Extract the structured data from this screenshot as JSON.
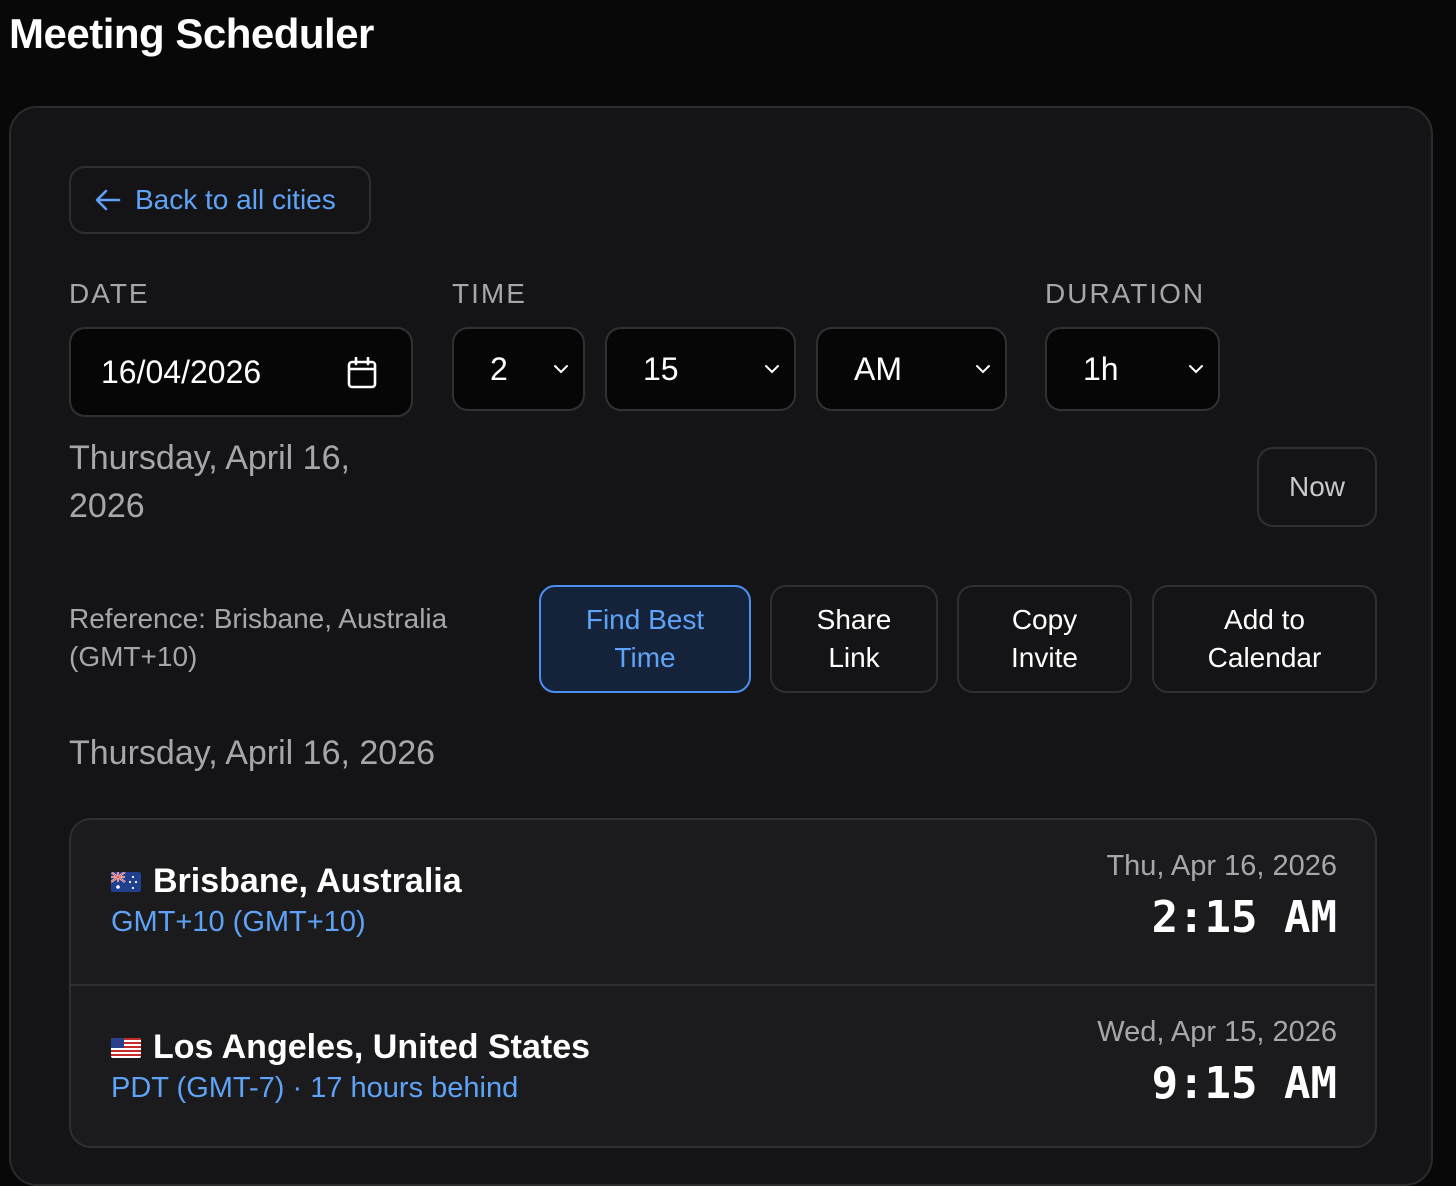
{
  "app": {
    "title": "Meeting Scheduler"
  },
  "nav": {
    "back_label": "Back to all cities",
    "back_icon": "arrow-left-icon"
  },
  "form": {
    "date_label": "DATE",
    "time_label": "TIME",
    "duration_label": "DURATION",
    "date_value": "16/04/2026",
    "hour_value": "2",
    "minute_value": "15",
    "ampm_value": "AM",
    "duration_value": "1h",
    "long_date": "Thursday, April 16, 2026",
    "now_label": "Now"
  },
  "reference": {
    "text": "Reference: Brisbane, Australia (GMT+10)"
  },
  "actions": {
    "find_best_time": "Find Best Time",
    "share_link": "Share Link",
    "copy_invite": "Copy Invite",
    "add_to_calendar": "Add to Calendar"
  },
  "results": {
    "section_date": "Thursday, April 16, 2026",
    "cities": [
      {
        "flag": "australia-flag",
        "name": "Brisbane, Australia",
        "tz": "GMT+10 (GMT+10)",
        "date": "Thu, Apr 16, 2026",
        "time": "2:15 AM"
      },
      {
        "flag": "united-states-flag",
        "name": "Los Angeles, United States",
        "tz": "PDT (GMT-7) · 17 hours behind",
        "date": "Wed, Apr 15, 2026",
        "time": "9:15 AM"
      }
    ]
  },
  "colors": {
    "background": "#080809",
    "panel": "#141416",
    "accent": "#5ea3f7",
    "muted_text": "#a6a6ad",
    "primary_button_bg": "#15233a"
  }
}
